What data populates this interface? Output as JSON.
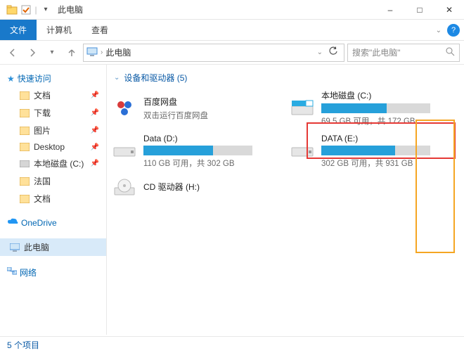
{
  "window": {
    "title": "此电脑",
    "minimize": "–",
    "maximize": "□",
    "close": "✕"
  },
  "ribbon": {
    "file": "文件",
    "computer": "计算机",
    "view": "查看"
  },
  "address": {
    "location": "此电脑",
    "search_placeholder": "搜索\"此电脑\""
  },
  "sidebar": {
    "quick_access": "快速访问",
    "items": [
      {
        "label": "文档",
        "pinned": true
      },
      {
        "label": "下载",
        "pinned": true
      },
      {
        "label": "图片",
        "pinned": true
      },
      {
        "label": "Desktop",
        "pinned": true
      },
      {
        "label": "本地磁盘 (C:)",
        "pinned": true
      },
      {
        "label": "法国",
        "pinned": false
      },
      {
        "label": "文档",
        "pinned": false
      }
    ],
    "onedrive": "OneDrive",
    "thispc": "此电脑",
    "network": "网络"
  },
  "section": {
    "header": "设备和驱动器 (5)"
  },
  "drives": {
    "baidu": {
      "name": "百度网盘",
      "sub": "双击运行百度网盘"
    },
    "c": {
      "name": "本地磁盘 (C:)",
      "sub": "69.5 GB 可用，共 172 GB",
      "fill": 60
    },
    "d": {
      "name": "Data (D:)",
      "sub": "110 GB 可用，共 302 GB",
      "fill": 64
    },
    "e": {
      "name": "DATA (E:)",
      "sub": "302 GB 可用，共 931 GB",
      "fill": 68
    },
    "cd": {
      "name": "CD 驱动器 (H:)",
      "sub": ""
    }
  },
  "status": {
    "text": "5 个项目"
  }
}
